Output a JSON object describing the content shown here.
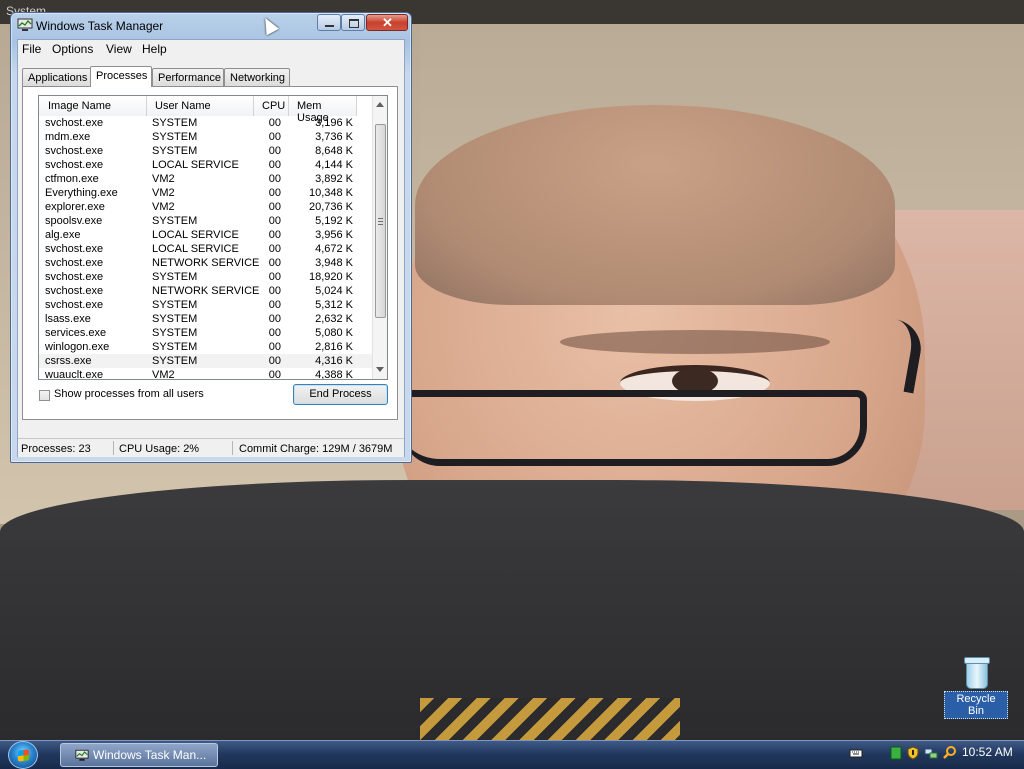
{
  "desktop": {
    "top_strip_text": "System",
    "icons": [
      {
        "label": "Recycle Bin",
        "icon": "recycle-bin-icon"
      }
    ]
  },
  "taskbar": {
    "start_icon": "windows-start-orb-icon",
    "tasks": [
      {
        "label": "Windows Task Man...",
        "icon": "task-manager-icon"
      }
    ],
    "tray_icons": [
      "keyboard-icon",
      "green-status-icon",
      "shield-icon",
      "network-icon",
      "search-icon"
    ],
    "clock": "10:52 AM"
  },
  "window": {
    "title": "Windows Task Manager",
    "menu": [
      "File",
      "Options",
      "View",
      "Help"
    ],
    "tabs": [
      {
        "label": "Applications",
        "active": false
      },
      {
        "label": "Processes",
        "active": true
      },
      {
        "label": "Performance",
        "active": false
      },
      {
        "label": "Networking",
        "active": false
      }
    ],
    "columns": [
      "Image Name",
      "User Name",
      "CPU",
      "Mem Usage"
    ],
    "processes": [
      {
        "name": "svchost.exe",
        "user": "SYSTEM",
        "cpu": "00",
        "mem": "3,196 K"
      },
      {
        "name": "mdm.exe",
        "user": "SYSTEM",
        "cpu": "00",
        "mem": "3,736 K"
      },
      {
        "name": "svchost.exe",
        "user": "SYSTEM",
        "cpu": "00",
        "mem": "8,648 K"
      },
      {
        "name": "svchost.exe",
        "user": "LOCAL SERVICE",
        "cpu": "00",
        "mem": "4,144 K"
      },
      {
        "name": "ctfmon.exe",
        "user": "VM2",
        "cpu": "00",
        "mem": "3,892 K"
      },
      {
        "name": "Everything.exe",
        "user": "VM2",
        "cpu": "00",
        "mem": "10,348 K"
      },
      {
        "name": "explorer.exe",
        "user": "VM2",
        "cpu": "00",
        "mem": "20,736 K"
      },
      {
        "name": "spoolsv.exe",
        "user": "SYSTEM",
        "cpu": "00",
        "mem": "5,192 K"
      },
      {
        "name": "alg.exe",
        "user": "LOCAL SERVICE",
        "cpu": "00",
        "mem": "3,956 K"
      },
      {
        "name": "svchost.exe",
        "user": "LOCAL SERVICE",
        "cpu": "00",
        "mem": "4,672 K"
      },
      {
        "name": "svchost.exe",
        "user": "NETWORK SERVICE",
        "cpu": "00",
        "mem": "3,948 K"
      },
      {
        "name": "svchost.exe",
        "user": "SYSTEM",
        "cpu": "00",
        "mem": "18,920 K"
      },
      {
        "name": "svchost.exe",
        "user": "NETWORK SERVICE",
        "cpu": "00",
        "mem": "5,024 K"
      },
      {
        "name": "svchost.exe",
        "user": "SYSTEM",
        "cpu": "00",
        "mem": "5,312 K"
      },
      {
        "name": "lsass.exe",
        "user": "SYSTEM",
        "cpu": "00",
        "mem": "2,632 K"
      },
      {
        "name": "services.exe",
        "user": "SYSTEM",
        "cpu": "00",
        "mem": "5,080 K"
      },
      {
        "name": "winlogon.exe",
        "user": "SYSTEM",
        "cpu": "00",
        "mem": "2,816 K"
      },
      {
        "name": "csrss.exe",
        "user": "SYSTEM",
        "cpu": "00",
        "mem": "4,316 K",
        "selected": true
      },
      {
        "name": "wuauclt.exe",
        "user": "VM2",
        "cpu": "00",
        "mem": "4,388 K"
      }
    ],
    "show_all_users_label": "Show processes from all users",
    "show_all_users_checked": false,
    "end_process_label": "End Process",
    "status": {
      "processes": "Processes: 23",
      "cpu_usage": "CPU Usage: 2%",
      "commit_charge": "Commit Charge: 129M / 3679M"
    }
  }
}
